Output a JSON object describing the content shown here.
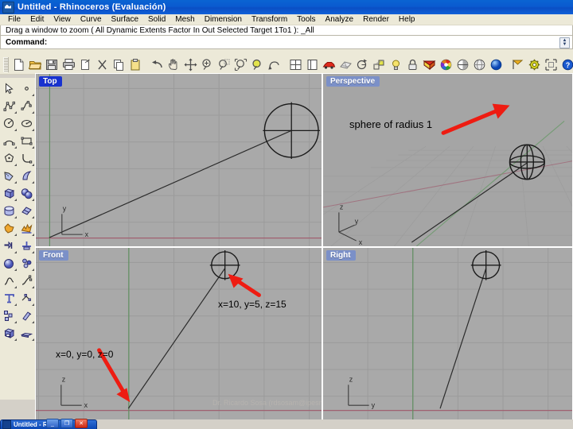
{
  "window": {
    "title": "Untitled - Rhinoceros (Evaluación)",
    "icon": "rhino-icon"
  },
  "menubar": {
    "items": [
      {
        "label": "File"
      },
      {
        "label": "Edit"
      },
      {
        "label": "View"
      },
      {
        "label": "Curve"
      },
      {
        "label": "Surface"
      },
      {
        "label": "Solid"
      },
      {
        "label": "Mesh"
      },
      {
        "label": "Dimension"
      },
      {
        "label": "Transform"
      },
      {
        "label": "Tools"
      },
      {
        "label": "Analyze"
      },
      {
        "label": "Render"
      },
      {
        "label": "Help"
      }
    ]
  },
  "prompt": {
    "history": "Drag a window to zoom ( All  Dynamic  Extents  Factor  In  Out  Selected  Target  1To1 ): _All",
    "command_label": "Command:",
    "command_value": "",
    "spinner_up": "▲",
    "spinner_down": "▼"
  },
  "toolbar": {
    "buttons": [
      {
        "name": "new-icon",
        "tip": "New"
      },
      {
        "name": "open-folder-icon",
        "tip": "Open"
      },
      {
        "name": "save-icon",
        "tip": "Save"
      },
      {
        "name": "print-icon",
        "tip": "Print"
      },
      {
        "name": "cut-icon",
        "tip": "Cut"
      },
      {
        "name": "scissors-icon",
        "tip": "Trim"
      },
      {
        "name": "copy-icon",
        "tip": "Copy"
      },
      {
        "name": "paste-icon",
        "tip": "Paste"
      },
      {
        "name": "undo-icon",
        "tip": "Undo"
      },
      {
        "name": "pan-hand-icon",
        "tip": "Pan"
      },
      {
        "name": "move-arrows-icon",
        "tip": "Move"
      },
      {
        "name": "zoom-in-icon",
        "tip": "Zoom In"
      },
      {
        "name": "zoom-dynamic-icon",
        "tip": "Zoom Dynamic"
      },
      {
        "name": "zoom-window-icon",
        "tip": "Zoom Window"
      },
      {
        "name": "zoom-extents-icon",
        "tip": "Zoom Extents"
      },
      {
        "name": "rotate-view-icon",
        "tip": "Rotate View"
      },
      {
        "name": "four-view-icon",
        "tip": "4 Viewports"
      },
      {
        "name": "single-view-icon",
        "tip": "1 Viewport"
      },
      {
        "name": "car-render-icon",
        "tip": "Render"
      },
      {
        "name": "mesh-icon",
        "tip": "Mesh"
      },
      {
        "name": "rotate-object-icon",
        "tip": "Rotate"
      },
      {
        "name": "scale-icon",
        "tip": "Scale"
      },
      {
        "name": "light-bulb-icon",
        "tip": "Light"
      },
      {
        "name": "lock-icon",
        "tip": "Lock"
      },
      {
        "name": "surface-fillet-icon",
        "tip": "Surface"
      },
      {
        "name": "color-wheel-icon",
        "tip": "Color"
      },
      {
        "name": "shade-half-icon",
        "tip": "Shade"
      },
      {
        "name": "render-preview-icon",
        "tip": "Render Preview"
      },
      {
        "name": "sphere-blue-icon",
        "tip": "Sphere"
      },
      {
        "name": "flag-icon",
        "tip": "Flag"
      },
      {
        "name": "gear-icon",
        "tip": "Options"
      },
      {
        "name": "group-icon",
        "tip": "Group"
      },
      {
        "name": "help-icon",
        "tip": "Help"
      }
    ]
  },
  "leftbar": {
    "column_a": [
      {
        "name": "select-arrow-icon"
      },
      {
        "name": "polyline-icon"
      },
      {
        "name": "circle-icon"
      },
      {
        "name": "arc-icon"
      },
      {
        "name": "ellipse-icon"
      },
      {
        "name": "curve-from-object-icon"
      },
      {
        "name": "box-solid-icon"
      },
      {
        "name": "cylinder-icon"
      },
      {
        "name": "boolean-union-icon"
      },
      {
        "name": "extrude-icon"
      },
      {
        "name": "sphere-solid-icon"
      },
      {
        "name": "blend-curve-icon"
      },
      {
        "name": "text-icon"
      },
      {
        "name": "array-icon"
      },
      {
        "name": "box-edit-icon"
      }
    ],
    "column_b": [
      {
        "name": "point-icon"
      },
      {
        "name": "control-point-curve-icon"
      },
      {
        "name": "ellipse-center-icon"
      },
      {
        "name": "rectangle-icon"
      },
      {
        "name": "fillet-corner-icon"
      },
      {
        "name": "surface-sweep-icon"
      },
      {
        "name": "two-spheres-icon"
      },
      {
        "name": "surface-patch-icon"
      },
      {
        "name": "explode-icon"
      },
      {
        "name": "split-icon"
      },
      {
        "name": "point-cloud-icon"
      },
      {
        "name": "curve-edit-icon"
      },
      {
        "name": "offset-icon"
      },
      {
        "name": "mirror-icon"
      },
      {
        "name": "planar-surface-icon"
      }
    ]
  },
  "viewports": [
    {
      "id": "top",
      "label": "Top",
      "label_state": "active",
      "axes": [
        "y",
        "x"
      ],
      "annotations": []
    },
    {
      "id": "perspective",
      "label": "Perspective",
      "label_state": "inactive",
      "axes": [
        "z",
        "y",
        "x"
      ],
      "annotations": [
        {
          "name": "sphere-radius-annotation",
          "text": "sphere  of radius 1"
        }
      ]
    },
    {
      "id": "front",
      "label": "Front",
      "label_state": "inactive",
      "axes": [
        "z",
        "x"
      ],
      "annotations": [
        {
          "name": "coordinate-annotation-sphere",
          "text": "x=10, y=5, z=15"
        },
        {
          "name": "coordinate-annotation-origin",
          "text": "x=0, y=0, z=0"
        }
      ],
      "watermark": "Dr. Ricardo Sosa (rdsosam@ipesm.mx)"
    },
    {
      "id": "right",
      "label": "Right",
      "label_state": "inactive",
      "axes": [
        "z",
        "y"
      ],
      "annotations": []
    }
  ],
  "taskbar": {
    "window_label": "Untitled - R...",
    "buttons": [
      {
        "name": "minimize-button",
        "glyph": "_"
      },
      {
        "name": "maximize-button",
        "glyph": "❐"
      },
      {
        "name": "close-button",
        "glyph": "✕"
      }
    ]
  },
  "colors": {
    "titlebar_blue": "#0a5ad0",
    "viewport_gray": "#a8a8a8",
    "arrow_red": "#ee1c12",
    "x_axis_red": "#c04060",
    "y_axis_green": "#3a8a3a",
    "label_active": "#1832d0",
    "label_inactive": "#7b90c8"
  }
}
